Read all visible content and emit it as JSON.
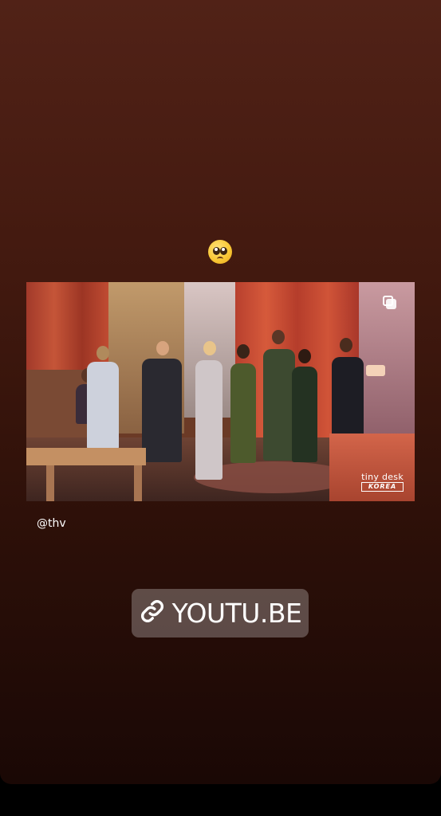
{
  "story": {
    "emoji_name": "pleading-face-emoji",
    "handle": "@thv",
    "video_logo": {
      "line1": "tiny desk",
      "line2": "KOREA"
    },
    "link_sticker": {
      "label": "YOUTU.BE",
      "icon": "link-icon"
    }
  },
  "colors": {
    "background_top": "#512217",
    "background_bottom": "#1a0805",
    "sticker_bg": "rgba(255,255,255,0.26)",
    "text": "#ffffff"
  }
}
